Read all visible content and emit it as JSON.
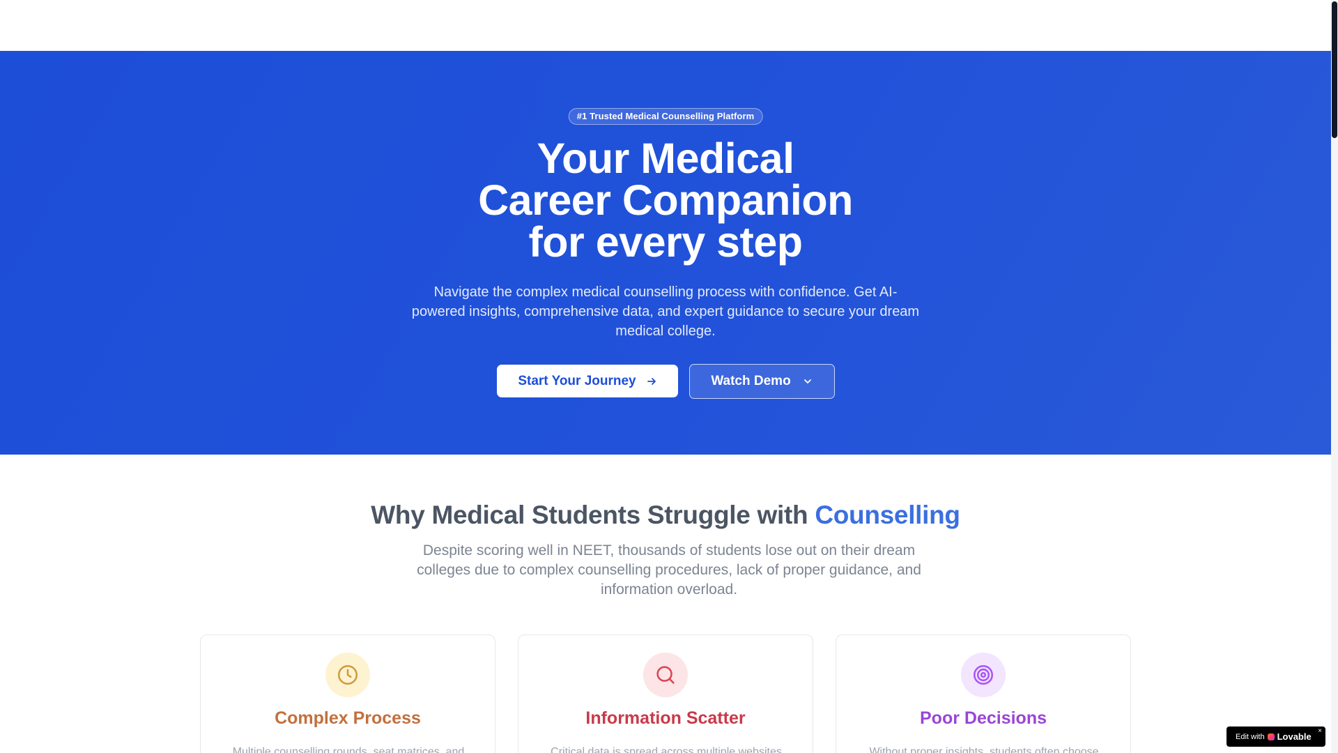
{
  "hero": {
    "badge": "#1 Trusted Medical Counselling Platform",
    "title_lines": [
      "Your Medical",
      "Career Companion",
      "for every step"
    ],
    "subtitle": "Navigate the complex medical counselling process with confidence. Get AI-powered insights, comprehensive data, and expert guidance to secure your dream medical college.",
    "primary_cta": "Start Your Journey",
    "secondary_cta": "Watch Demo",
    "primary_cta_icon": "arrow-right-icon",
    "secondary_cta_icon": "chevron-down-icon"
  },
  "why": {
    "title_prefix": "Why Medical Students Struggle with",
    "title_accent": "Counselling",
    "subtitle": "Despite scoring well in NEET, thousands of students lose out on their dream colleges due to complex counselling procedures, lack of proper guidance, and information overload."
  },
  "cards": [
    {
      "title": "Complex Process",
      "description": "Multiple counselling rounds, seat matrices, and",
      "icon": "clock-icon",
      "color": "#c2703d",
      "icon_color": "#d19a3c",
      "icon_bg": "#fdf3d0"
    },
    {
      "title": "Information Scatter",
      "description": "Critical data is spread across multiple websites",
      "icon": "search-icon",
      "color": "#c93a4a",
      "icon_color": "#dc4453",
      "icon_bg": "#fde4e6"
    },
    {
      "title": "Poor Decisions",
      "description": "Without proper insights, students often choose",
      "icon": "target-icon",
      "color": "#9a45d6",
      "icon_color": "#a855f7",
      "icon_bg": "#f3e5fd"
    }
  ],
  "badge": {
    "edit_with": "Edit with",
    "brand": "Lovable",
    "close": "×"
  },
  "colors": {
    "hero_bg": "#1d4ed8",
    "accent": "#3b6fe0"
  }
}
